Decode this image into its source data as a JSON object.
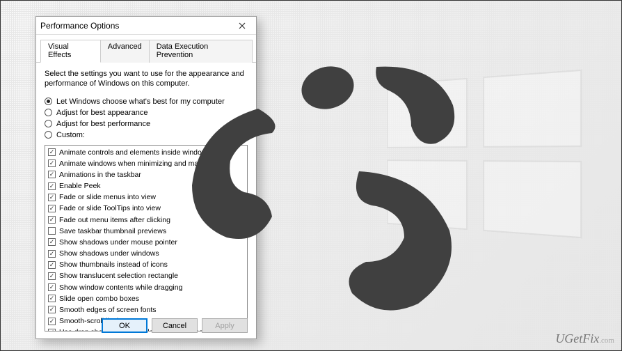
{
  "dialog": {
    "title": "Performance Options",
    "tabs": [
      {
        "label": "Visual Effects",
        "active": true
      },
      {
        "label": "Advanced",
        "active": false
      },
      {
        "label": "Data Execution Prevention",
        "active": false
      }
    ],
    "description": "Select the settings you want to use for the appearance and performance of Windows on this computer.",
    "radios": [
      {
        "label": "Let Windows choose what's best for my computer",
        "checked": true
      },
      {
        "label": "Adjust for best appearance",
        "checked": false
      },
      {
        "label": "Adjust for best performance",
        "checked": false
      },
      {
        "label": "Custom:",
        "checked": false
      }
    ],
    "options": [
      {
        "label": "Animate controls and elements inside windows",
        "checked": true
      },
      {
        "label": "Animate windows when minimizing and maximizing",
        "checked": true
      },
      {
        "label": "Animations in the taskbar",
        "checked": true
      },
      {
        "label": "Enable Peek",
        "checked": true
      },
      {
        "label": "Fade or slide menus into view",
        "checked": true
      },
      {
        "label": "Fade or slide ToolTips into view",
        "checked": true
      },
      {
        "label": "Fade out menu items after clicking",
        "checked": true
      },
      {
        "label": "Save taskbar thumbnail previews",
        "checked": false
      },
      {
        "label": "Show shadows under mouse pointer",
        "checked": true
      },
      {
        "label": "Show shadows under windows",
        "checked": true
      },
      {
        "label": "Show thumbnails instead of icons",
        "checked": true
      },
      {
        "label": "Show translucent selection rectangle",
        "checked": true
      },
      {
        "label": "Show window contents while dragging",
        "checked": true
      },
      {
        "label": "Slide open combo boxes",
        "checked": true
      },
      {
        "label": "Smooth edges of screen fonts",
        "checked": true
      },
      {
        "label": "Smooth-scroll list boxes",
        "checked": true
      },
      {
        "label": "Use drop shadows for icon labels on the desktop",
        "checked": true
      }
    ],
    "buttons": {
      "ok": "OK",
      "cancel": "Cancel",
      "apply": "Apply"
    }
  },
  "watermark": {
    "brand": "UGetFix",
    "tld": ".com"
  }
}
